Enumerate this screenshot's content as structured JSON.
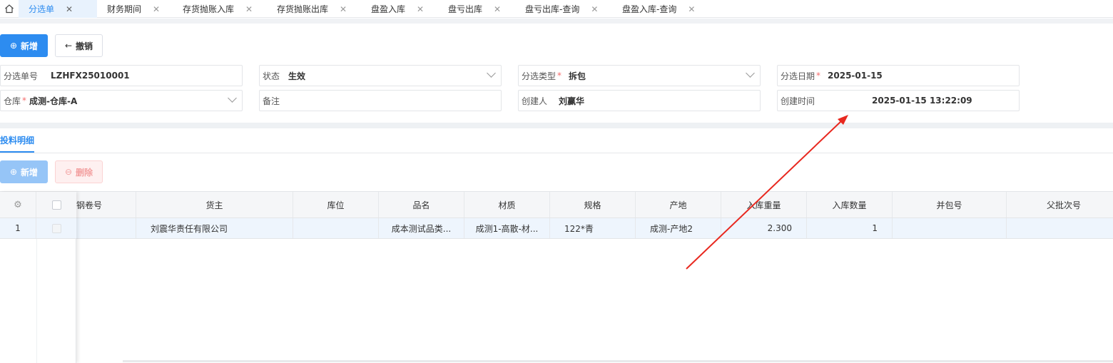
{
  "tabs": [
    {
      "label": "分选单",
      "active": true
    },
    {
      "label": "财务期间",
      "active": false
    },
    {
      "label": "存货抛账入库",
      "active": false
    },
    {
      "label": "存货抛账出库",
      "active": false
    },
    {
      "label": "盘盈入库",
      "active": false
    },
    {
      "label": "盘亏出库",
      "active": false
    },
    {
      "label": "盘亏出库-查询",
      "active": false
    },
    {
      "label": "盘盈入库-查询",
      "active": false
    }
  ],
  "toolbar": {
    "add_label": "新增",
    "revoke_label": "撤销"
  },
  "form": {
    "order_no": {
      "label": "分选单号",
      "value": "LZHFX25010001"
    },
    "status": {
      "label": "状态",
      "value": "生效"
    },
    "sort_type": {
      "label": "分选类型",
      "value": "拆包"
    },
    "sort_date": {
      "label": "分选日期",
      "value": "2025-01-15"
    },
    "warehouse": {
      "label": "仓库",
      "value": "成测-仓库-A"
    },
    "remark": {
      "label": "备注",
      "value": ""
    },
    "creator": {
      "label": "创建人",
      "value": "刘赢华"
    },
    "created_time": {
      "label": "创建时间",
      "value": "2025-01-15 13:22:09"
    },
    "required_mark": "*"
  },
  "detail": {
    "tab_label": "投料明细",
    "add_label": "新增",
    "delete_label": "删除",
    "columns": [
      "钢卷号",
      "货主",
      "库位",
      "品名",
      "材质",
      "规格",
      "产地",
      "入库重量",
      "入库数量",
      "并包号",
      "父批次号"
    ],
    "rows": [
      {
        "index": "1",
        "coil_no": "",
        "owner": "刘震华责任有限公司",
        "location": "",
        "product": "成本测试品类...",
        "material": "成测1-高散-材...",
        "spec": "122*青",
        "origin": "成测-产地2",
        "weight": "2.300",
        "qty": "1",
        "bundle_no": "",
        "parent_batch": ""
      }
    ]
  },
  "colors": {
    "accent": "#2d8cf0",
    "danger": "#f56c6c",
    "annotation": "#e8281f"
  }
}
